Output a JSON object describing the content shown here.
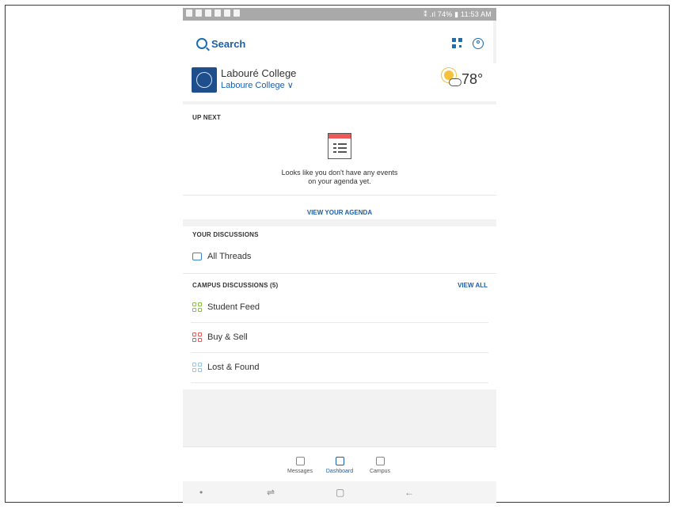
{
  "status_bar": {
    "right_text": "⁑ .ıl 74% ▮ 11:53 AM"
  },
  "search": {
    "label": "Search"
  },
  "college": {
    "name": "Labouré College",
    "selector": "Laboure College ∨"
  },
  "weather": {
    "temperature": "78°"
  },
  "up_next": {
    "title": "UP NEXT",
    "empty_line1": "Looks like you don't have any events",
    "empty_line2": "on your agenda yet.",
    "action": "VIEW YOUR AGENDA"
  },
  "your_discussions": {
    "title": "YOUR DISCUSSIONS",
    "all_threads": "All Threads"
  },
  "campus_discussions": {
    "title": "CAMPUS DISCUSSIONS (5)",
    "view_all": "VIEW ALL",
    "items": [
      {
        "label": "Student Feed",
        "color": "#8bc34a"
      },
      {
        "label": "Buy & Sell",
        "color": "#e35d5d"
      },
      {
        "label": "Lost & Found",
        "color": "#9ac4e8"
      }
    ]
  },
  "bottom_nav": {
    "messages": "Messages",
    "dashboard": "Dashboard",
    "campus": "Campus"
  },
  "colors": {
    "accent": "#1d5fa8"
  }
}
